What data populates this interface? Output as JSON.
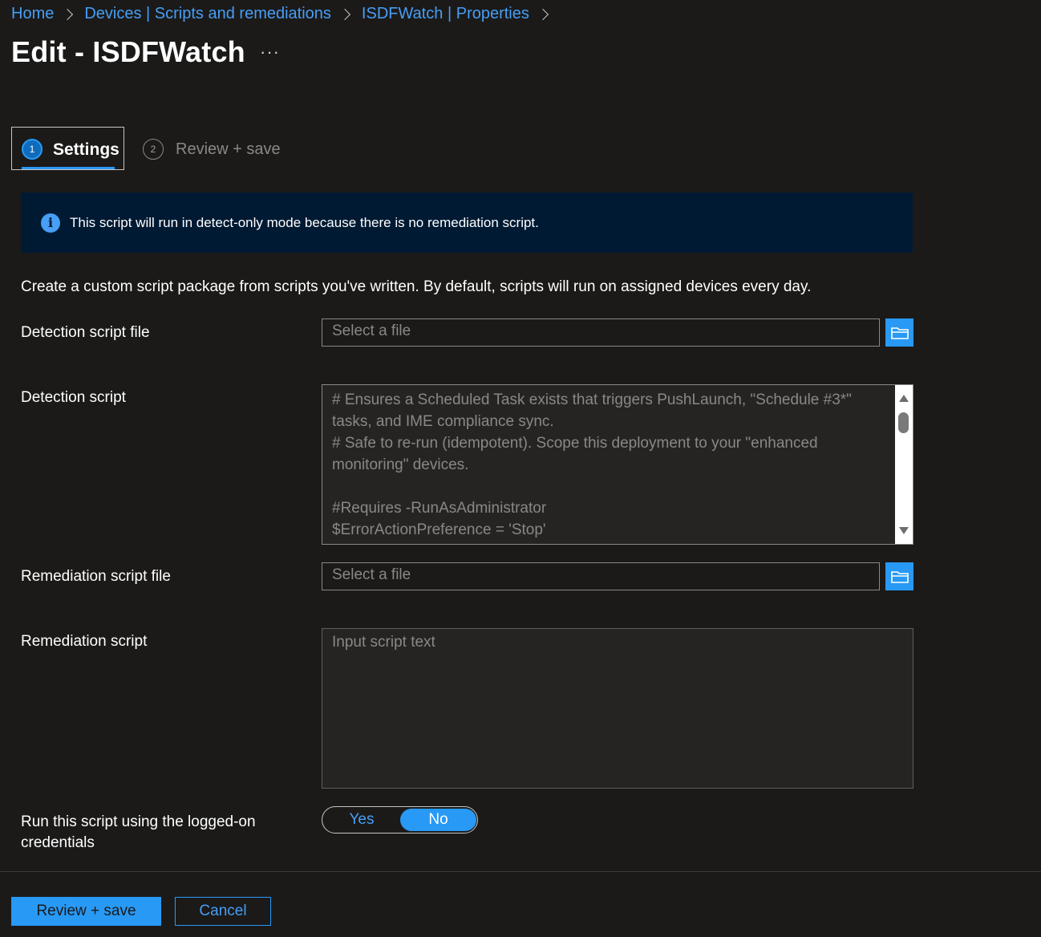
{
  "breadcrumb": {
    "items": [
      "Home",
      "Devices | Scripts and remediations",
      "ISDFWatch | Properties"
    ]
  },
  "page": {
    "title": "Edit - ISDFWatch",
    "more": "···"
  },
  "wizard": {
    "steps": [
      {
        "number": "1",
        "label": "Settings",
        "active": true
      },
      {
        "number": "2",
        "label": "Review + save",
        "active": false
      }
    ]
  },
  "info_banner": {
    "icon": "info-icon",
    "text": "This script will run in detect-only mode because there is no remediation script."
  },
  "form": {
    "description": "Create a custom script package from scripts you've written. By default, scripts will run on assigned devices every day.",
    "detection_file": {
      "label": "Detection script file",
      "placeholder": "Select a file",
      "browse_icon": "folder-icon"
    },
    "detection_script": {
      "label": "Detection script",
      "text": "# Ensures a Scheduled Task exists that triggers PushLaunch, \"Schedule #3*\" tasks, and IME compliance sync.\n# Safe to re-run (idempotent). Scope this deployment to your \"enhanced monitoring\" devices.\n\n#Requires -RunAsAdministrator\n$ErrorActionPreference = 'Stop'"
    },
    "remediation_file": {
      "label": "Remediation script file",
      "placeholder": "Select a file",
      "browse_icon": "folder-icon"
    },
    "remediation_script": {
      "label": "Remediation script",
      "placeholder": "Input script text"
    },
    "run_as_logged_on": {
      "label": "Run this script using the logged-on credentials",
      "options": [
        "Yes",
        "No"
      ],
      "selected": "No"
    }
  },
  "footer": {
    "primary": "Review + save",
    "secondary": "Cancel"
  },
  "colors": {
    "background": "#1b1a19",
    "accent": "#2899f5",
    "link": "#479ef5",
    "banner": "#001a33"
  }
}
